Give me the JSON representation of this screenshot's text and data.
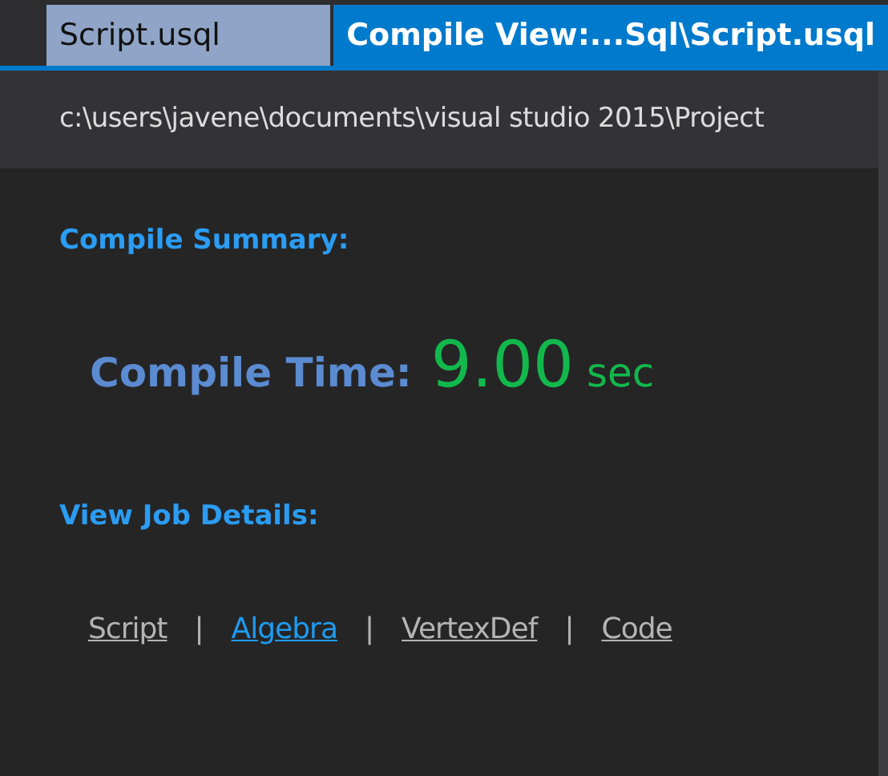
{
  "tabs": [
    {
      "label": "Script.usql",
      "selected": false
    },
    {
      "label": "Compile View:...Sql\\Script.usql",
      "selected": true
    }
  ],
  "path": "c:\\users\\javene\\documents\\visual studio 2015\\Project",
  "summary": {
    "heading": "Compile Summary:",
    "label": "Compile Time:",
    "value": "9.00",
    "unit": "sec"
  },
  "details": {
    "heading": "View Job Details:",
    "links": [
      {
        "label": "Script",
        "selected": false
      },
      {
        "label": "Algebra",
        "selected": true
      },
      {
        "label": "VertexDef",
        "selected": false
      },
      {
        "label": "Code",
        "selected": false
      }
    ],
    "separators": [
      "|",
      "|",
      "|"
    ]
  }
}
